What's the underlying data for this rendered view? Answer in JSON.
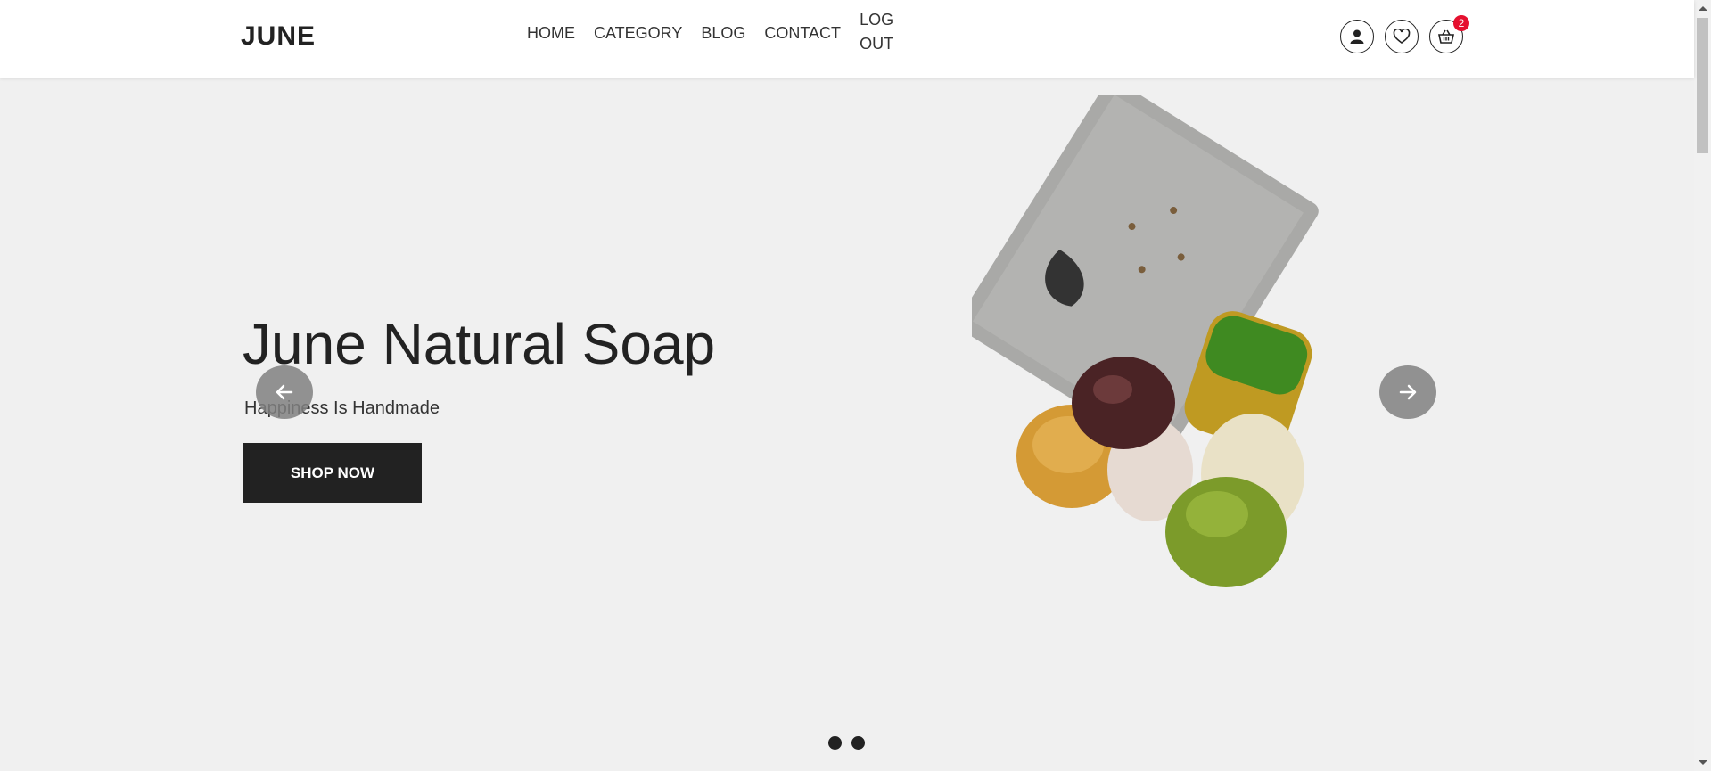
{
  "brand": {
    "logo": "JUNE"
  },
  "nav": {
    "items": [
      {
        "label": "HOME"
      },
      {
        "label": "CATEGORY"
      },
      {
        "label": "BLOG"
      },
      {
        "label": "CONTACT"
      },
      {
        "label": "LOG OUT"
      }
    ]
  },
  "header_icons": {
    "user": "user-icon",
    "wishlist": "heart-icon",
    "cart": "basket-icon",
    "cart_count": "2"
  },
  "hero": {
    "title": "June Natural Soap",
    "subtitle": "Happiness Is Handmade",
    "cta_label": "SHOP NOW",
    "slide_count": 2
  },
  "colors": {
    "background": "#f0f0f0",
    "header": "#ffffff",
    "dark": "#222222",
    "badge": "#e5102f",
    "arrow": "#808080"
  }
}
